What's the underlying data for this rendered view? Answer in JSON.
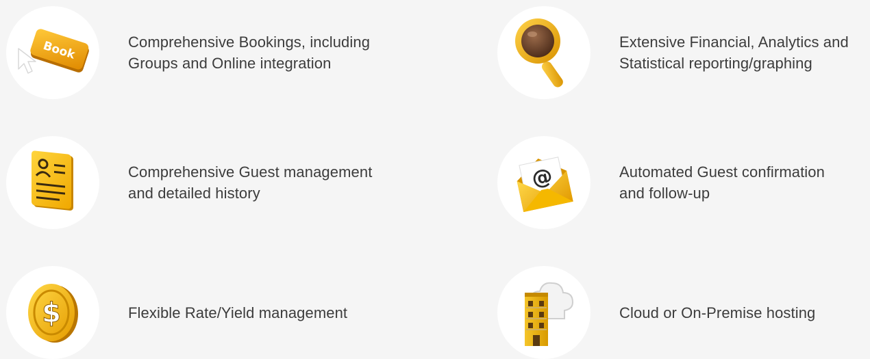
{
  "colors": {
    "background": "#f5f5f5",
    "circle": "#ffffff",
    "text": "#3c3c3c",
    "icon_gold": "#f2b705",
    "icon_gold_dark": "#c98a00"
  },
  "features": [
    {
      "icon": "book-button-icon",
      "icon_text": "Book",
      "line1": "Comprehensive Bookings, including",
      "line2": "Groups and Online integration"
    },
    {
      "icon": "magnifying-glass-icon",
      "line1": "Extensive Financial, Analytics and",
      "line2": "Statistical reporting/graphing"
    },
    {
      "icon": "guest-profile-card-icon",
      "line1": "Comprehensive Guest management",
      "line2": "and detailed history"
    },
    {
      "icon": "email-envelope-icon",
      "icon_text": "@",
      "line1": "Automated Guest confirmation",
      "line2": "and follow-up"
    },
    {
      "icon": "dollar-coin-icon",
      "icon_text": "$",
      "line1": "Flexible Rate/Yield management",
      "line2": ""
    },
    {
      "icon": "cloud-building-icon",
      "line1": "Cloud or On-Premise hosting",
      "line2": ""
    }
  ]
}
